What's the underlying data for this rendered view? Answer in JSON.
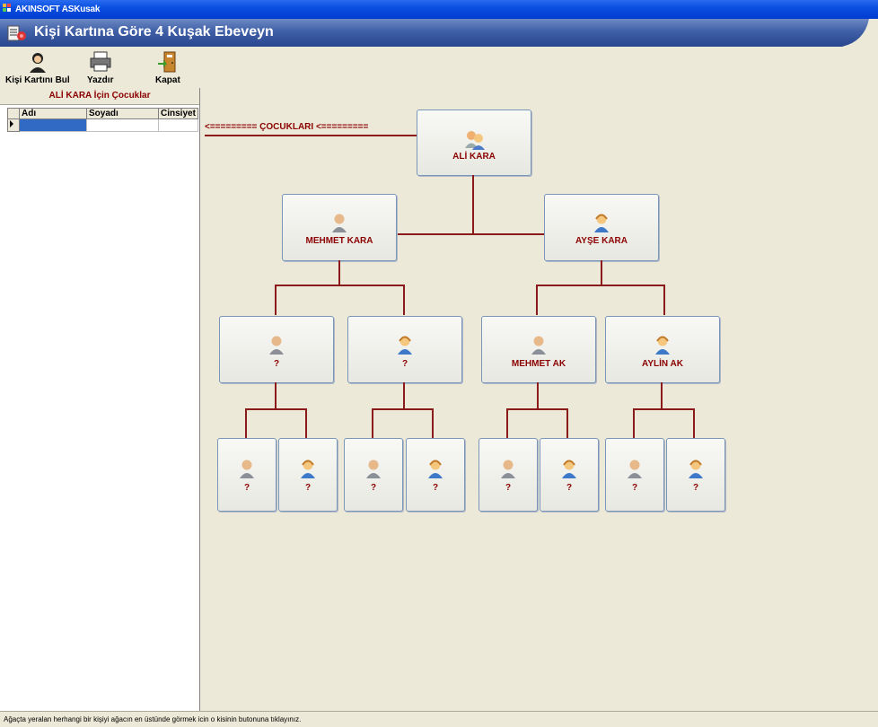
{
  "window": {
    "title": "AKINSOFT ASKusak"
  },
  "banner": {
    "title": "Kişi Kartına Göre 4 Kuşak Ebeveyn"
  },
  "toolbar": {
    "find_label": "Kişi Kartını Bul",
    "print_label": "Yazdır",
    "close_label": "Kapat"
  },
  "left_panel": {
    "title": "ALİ KARA İçin Çocuklar",
    "columns": [
      "Adı",
      "Soyadı",
      "Cinsiyet"
    ]
  },
  "tree": {
    "children_arrow": "<========= ÇOCUKLARI <=========",
    "root": "ALİ KARA",
    "gen1": [
      "MEHMET KARA",
      "AYŞE KARA"
    ],
    "gen2": [
      "?",
      "?",
      "MEHMET AK",
      "AYLİN AK"
    ],
    "gen3": [
      "?",
      "?",
      "?",
      "?",
      "?",
      "?",
      "?",
      "?"
    ]
  },
  "status": {
    "text": "Ağaçta yeralan herhangi bir kişiyi ağacın en üstünde görmek icin o kisinin butonuna tıklayınız."
  },
  "colors": {
    "accent": "#8b0000",
    "title_bar": "#0a4fe0"
  }
}
